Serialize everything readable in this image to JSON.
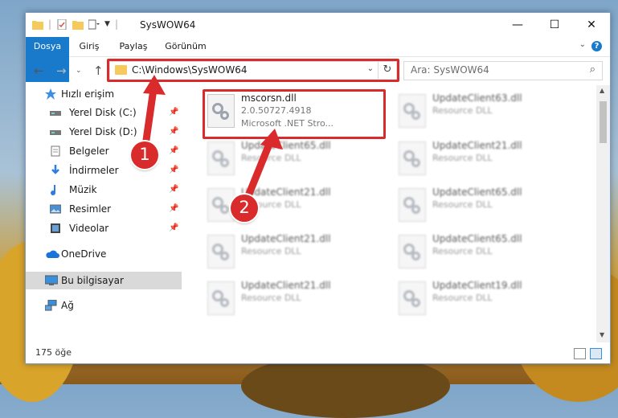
{
  "window": {
    "title": "SysWOW64"
  },
  "ribbon": {
    "tabs": [
      "Dosya",
      "Giriş",
      "Paylaş",
      "Görünüm"
    ]
  },
  "nav": {
    "address": "C:\\Windows\\SysWOW64",
    "search_placeholder": "Ara: SysWOW64"
  },
  "sidebar": {
    "items": [
      {
        "label": "Hızlı erişim",
        "icon": "star-icon"
      },
      {
        "label": "Yerel Disk (C:)",
        "icon": "drive-icon",
        "pinned": true
      },
      {
        "label": "Yerel Disk (D:)",
        "icon": "drive-icon",
        "pinned": true
      },
      {
        "label": "Belgeler",
        "icon": "documents-icon",
        "pinned": true
      },
      {
        "label": "İndirmeler",
        "icon": "download-icon",
        "pinned": true
      },
      {
        "label": "Müzik",
        "icon": "music-icon",
        "pinned": true
      },
      {
        "label": "Resimler",
        "icon": "pictures-icon",
        "pinned": true
      },
      {
        "label": "Videolar",
        "icon": "video-icon",
        "pinned": true
      },
      {
        "label": "OneDrive",
        "icon": "cloud-icon"
      },
      {
        "label": "Bu bilgisayar",
        "icon": "computer-icon",
        "selected": true
      },
      {
        "label": "Ağ",
        "icon": "network-icon"
      }
    ]
  },
  "files": [
    {
      "name": "mscorsn.dll",
      "line2": "2.0.50727.4918",
      "line3": "Microsoft .NET Stro..."
    },
    {
      "name": "UpdateClient63.dll",
      "line2": "Resource DLL"
    },
    {
      "name": "UpdateClient65.dll",
      "line2": "Resource DLL"
    },
    {
      "name": "UpdateClient21.dll",
      "line2": "Resource DLL"
    },
    {
      "name": "UpdateClient21.dll",
      "line2": "Resource DLL"
    },
    {
      "name": "UpdateClient65.dll",
      "line2": "Resource DLL"
    },
    {
      "name": "UpdateClient21.dll",
      "line2": "Resource DLL"
    },
    {
      "name": "UpdateClient65.dll",
      "line2": "Resource DLL"
    },
    {
      "name": "UpdateClient21.dll",
      "line2": "Resource DLL"
    },
    {
      "name": "UpdateClient19.dll",
      "line2": "Resource DLL"
    }
  ],
  "status": {
    "item_count": "175 öğe"
  },
  "annotations": {
    "marker1": "1",
    "marker2": "2"
  },
  "colors": {
    "accent": "#1979ca",
    "highlight": "#d92b2b"
  }
}
